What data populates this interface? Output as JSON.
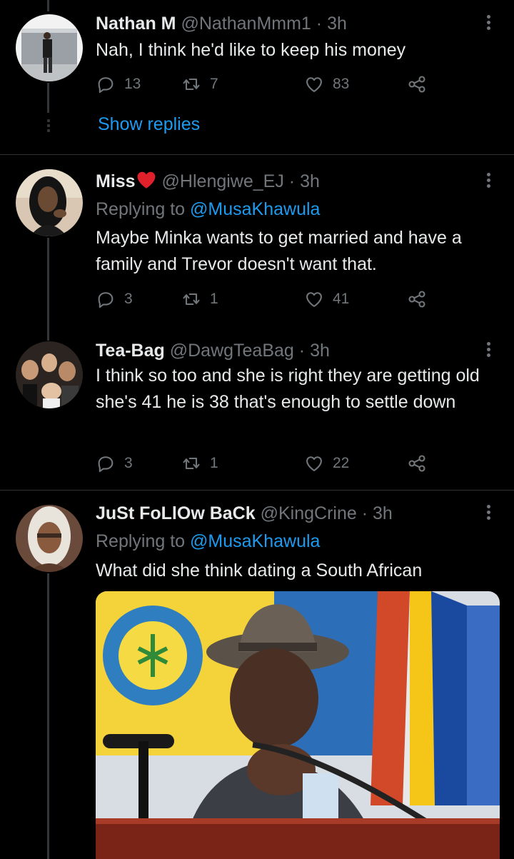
{
  "tweets": [
    {
      "name": "Nathan M",
      "handle": "@NathanMmm1",
      "separator": "·",
      "time": "3h",
      "text": "Nah, I think he'd like to keep his money",
      "replies": "13",
      "retweets": "7",
      "likes": "83",
      "show_replies": "Show replies"
    },
    {
      "name": "Miss",
      "name_emoji": "red-heart",
      "handle": "@Hlengiwe_EJ",
      "separator": "·",
      "time": "3h",
      "replying_prefix": "Replying to",
      "replying_to": "@MusaKhawula",
      "text": "Maybe Minka wants to get married and have a family and Trevor doesn't want that.",
      "replies": "3",
      "retweets": "1",
      "likes": "41"
    },
    {
      "name": "Tea-Bag",
      "handle": "@DawgTeaBag",
      "separator": "·",
      "time": "3h",
      "text": "I think so too and she is right they are getting old she's 41 he is 38 that's enough to settle down",
      "replies": "3",
      "retweets": "1",
      "likes": "22"
    },
    {
      "name": "JuSt FoLlOw BaCk",
      "handle": "@KingCrine",
      "separator": "·",
      "time": "3h",
      "replying_prefix": "Replying to",
      "replying_to": "@MusaKhawula",
      "text": "What did she think dating a South African"
    }
  ],
  "colors": {
    "background": "#000000",
    "text_primary": "#e7e9ea",
    "text_secondary": "#71767b",
    "accent": "#1d9bf0",
    "divider": "#2f3336",
    "heart": "#f91880"
  },
  "icons": [
    "reply-icon",
    "retweet-icon",
    "like-icon",
    "share-icon",
    "more-icon"
  ]
}
